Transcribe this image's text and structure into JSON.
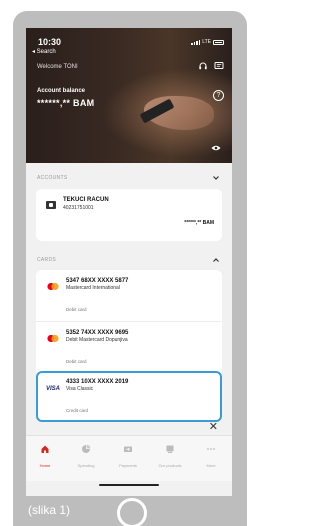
{
  "status": {
    "time": "10:30",
    "back_label": "◂ Search",
    "network": "LTE"
  },
  "header": {
    "welcome": "Welcome TONI",
    "balance_label": "Account balance",
    "balance_value": "******,** BAM"
  },
  "accounts": {
    "section_title": "ACCOUNTS",
    "items": [
      {
        "name": "TEKUCI RACUN",
        "number": "40231751001",
        "balance": "******,** BAM"
      }
    ]
  },
  "cards": {
    "section_title": "CARDS",
    "items": [
      {
        "number": "5347 68XX XXXX 5877",
        "type": "Mastercard International",
        "sub": "Debit card",
        "brand": "mastercard",
        "selected": false
      },
      {
        "number": "5352 74XX XXXX 9695",
        "type": "Debit Mastercard Dopunjiva",
        "sub": "Debit card",
        "brand": "mastercard",
        "selected": false
      },
      {
        "number": "4333 10XX XXXX 2019",
        "type": "Visa Classic",
        "sub": "Credit card",
        "brand": "visa",
        "selected": true
      }
    ]
  },
  "tabbar": {
    "items": [
      {
        "label": "Home",
        "icon": "home-icon",
        "active": true
      },
      {
        "label": "Spending",
        "icon": "pie-chart-icon",
        "active": false
      },
      {
        "label": "Payments",
        "icon": "payments-icon",
        "active": false
      },
      {
        "label": "Our products",
        "icon": "products-icon",
        "active": false
      },
      {
        "label": "More",
        "icon": "more-icon",
        "active": false
      }
    ]
  },
  "caption": "(slika 1)",
  "colors": {
    "accent": "#d42a1e",
    "selection": "#3a9bd5",
    "visa": "#1a1f71"
  }
}
